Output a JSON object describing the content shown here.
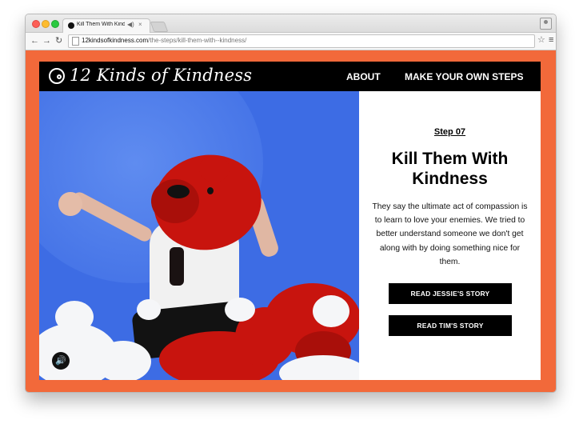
{
  "browser": {
    "tab_title": "Kill Them With Kindness",
    "tab_audio_icon": "speaker-icon",
    "tab_close": "×",
    "nav_back": "←",
    "nav_forward": "→",
    "nav_reload": "↻",
    "url_host": "12kindsofkindness.com",
    "url_path": "/the-steps/kill-them-with--kindness/",
    "bookmark": "☆",
    "menu": "≡"
  },
  "site": {
    "logo_text": "12 Kinds of Kindness",
    "nav": [
      "ABOUT",
      "MAKE YOUR OWN STEPS"
    ],
    "accent_color": "#f2693a",
    "header_color": "#000000"
  },
  "hero": {
    "sound_icon": "speaker-icon",
    "sound_glyph": "🔊",
    "background_color": "#3d6ce4"
  },
  "story": {
    "step_label": "Step 07",
    "title_line1": "Kill Them With",
    "title_line2": "Kindness",
    "body": "They say the ultimate act of compassion is to learn to love your enemies. We tried to better understand someone we don't get along with by doing something nice for them.",
    "buttons": [
      "READ JESSIE'S STORY",
      "READ TIM'S STORY"
    ]
  }
}
